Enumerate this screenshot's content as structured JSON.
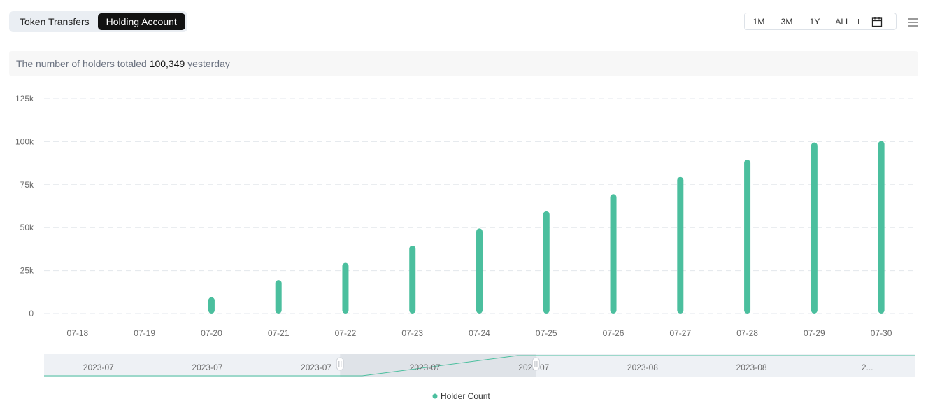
{
  "tabs": [
    {
      "label": "Token Transfers",
      "active": false
    },
    {
      "label": "Holding Account",
      "active": true
    }
  ],
  "range_options": [
    "1M",
    "3M",
    "1Y",
    "ALL"
  ],
  "icons": {
    "calendar": "calendar-icon",
    "menu": "hamburger-menu-icon"
  },
  "summary": {
    "prefix": "The number of holders totaled",
    "value": "100,349",
    "suffix": "yesterday"
  },
  "colors": {
    "bar": "#4bbf9e",
    "grid": "#e3e7ec",
    "axis_text": "#6b6b6b"
  },
  "chart_data": {
    "type": "bar",
    "title": "",
    "xlabel": "",
    "ylabel": "",
    "categories": [
      "07-18",
      "07-19",
      "07-20",
      "07-21",
      "07-22",
      "07-23",
      "07-24",
      "07-25",
      "07-26",
      "07-27",
      "07-28",
      "07-29",
      "07-30"
    ],
    "series": [
      {
        "name": "Holder Count",
        "values": [
          0,
          0,
          9500,
          19500,
          29500,
          39500,
          49500,
          59500,
          69500,
          79500,
          89500,
          99500,
          100349
        ]
      }
    ],
    "ylim": [
      0,
      125000
    ],
    "yticks": [
      0,
      25000,
      50000,
      75000,
      100000,
      125000
    ],
    "ytick_labels": [
      "0",
      "25k",
      "50k",
      "75k",
      "100k",
      "125k"
    ],
    "grid": true,
    "legend": {
      "position": "bottom-center",
      "entries": [
        "Holder Count"
      ]
    },
    "datazoom": {
      "labels": [
        "2023-07",
        "2023-07",
        "2023-07",
        "2023-07",
        "2023-07",
        "2023-08",
        "2023-08",
        "2..."
      ],
      "selected_start_fraction": 0.34,
      "selected_end_fraction": 0.565
    }
  }
}
